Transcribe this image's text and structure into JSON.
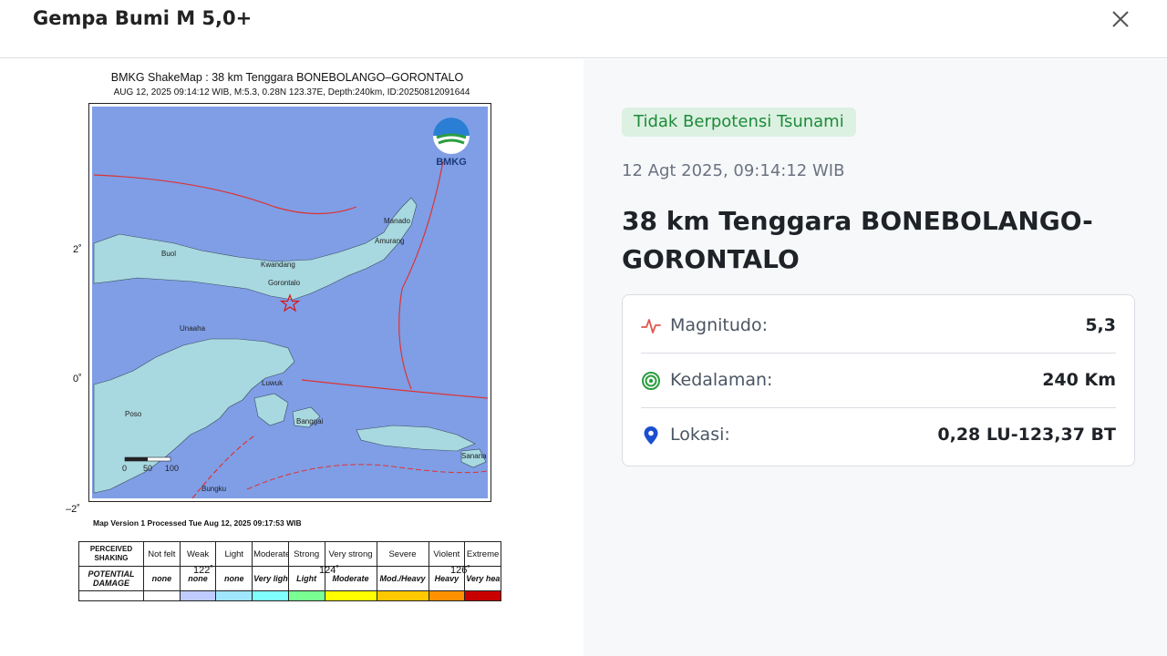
{
  "header": {
    "title": "Gempa Bumi M 5,0+"
  },
  "map": {
    "title": "BMKG ShakeMap : 38 km Tenggara BONEBOLANGO–GORONTALO",
    "subtitle": "AUG 12, 2025 09:14:12 WIB, M:5.3, 0.28N 123.37E, Depth:240km, ID:20250812091644",
    "logo_text": "BMKG",
    "lat_ticks": [
      "2˚",
      "0˚",
      "–2˚"
    ],
    "lon_ticks": [
      "122˚",
      "124˚",
      "126˚"
    ],
    "place_labels": [
      "Buol",
      "Kwandang",
      "Gorontalo",
      "Manado",
      "Amurang",
      "Unaaha",
      "Luwuk",
      "Banggai",
      "Poso",
      "Bungku",
      "Sanana"
    ],
    "scale_labels": [
      "0",
      "50",
      "100"
    ],
    "version_text": "Map Version 1 Processed Tue Aug 12, 2025 09:17:53 WIB",
    "legend": {
      "shaking_header": "PERCEIVED SHAKING",
      "damage_header": "POTENTIAL DAMAGE",
      "shaking": [
        "Not felt",
        "Weak",
        "Light",
        "Moderate",
        "Strong",
        "Very strong",
        "Severe",
        "Violent",
        "Extreme"
      ],
      "damage": [
        "none",
        "none",
        "none",
        "Very light",
        "Light",
        "Moderate",
        "Mod./Heavy",
        "Heavy",
        "Very heavy"
      ],
      "colors": [
        "#ffffff",
        "#bfccff",
        "#a0e6ff",
        "#80ffff",
        "#7aff93",
        "#ffff00",
        "#ffc800",
        "#ff9100",
        "#c80000"
      ]
    }
  },
  "info": {
    "tsunami_badge": "Tidak Berpotensi Tsunami",
    "datetime": "12 Agt 2025, 09:14:12 WIB",
    "location": "38 km Tenggara BONEBOLANGO-GORONTALO",
    "rows": [
      {
        "icon": "activity-icon",
        "label": "Magnitudo:",
        "value": "5,3"
      },
      {
        "icon": "target-icon",
        "label": "Kedalaman:",
        "value": "240 Km"
      },
      {
        "icon": "map-pin-icon",
        "label": "Lokasi:",
        "value": "0,28 LU-123,37 BT"
      }
    ]
  },
  "colors": {
    "sea": "#7f9ee6",
    "land": "#a8d8e0",
    "badge_bg": "#dcf1e1",
    "badge_text": "#1d8a3a",
    "magnitude_icon": "#e0554f",
    "depth_icon": "#2a9d3f",
    "location_icon": "#1b4fd1"
  }
}
